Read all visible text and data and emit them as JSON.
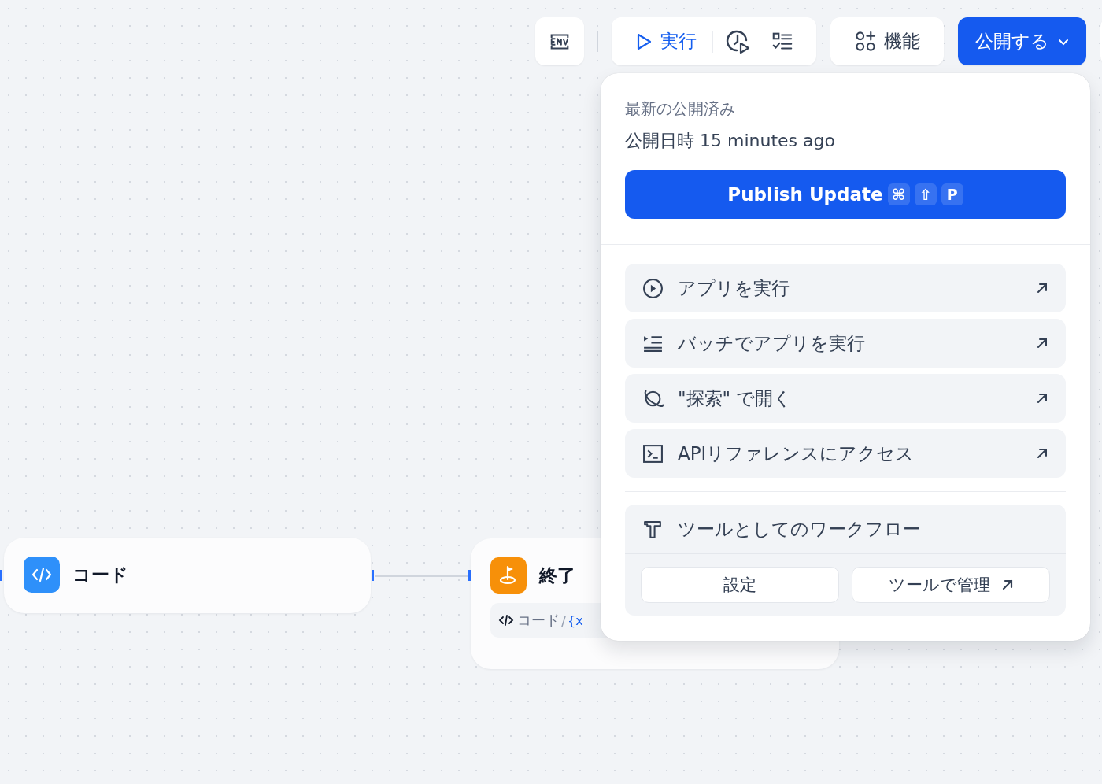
{
  "toolbar": {
    "run_button": {
      "label": "実行"
    },
    "features_button": {
      "label": "機能"
    },
    "publish_button": {
      "label": "公開する"
    }
  },
  "publish_menu": {
    "heading": "最新の公開済み",
    "published_time": "公開日時 15 minutes ago",
    "publish_update_button": {
      "label": "Publish Update",
      "shortcut_keys": [
        "⌘",
        "⇧",
        "P"
      ]
    },
    "actions": [
      {
        "kind": "run",
        "label": "アプリを実行"
      },
      {
        "kind": "batch",
        "label": "バッチでアプリを実行"
      },
      {
        "kind": "explore",
        "label": "\"探索\" で開く"
      },
      {
        "kind": "api",
        "label": "APIリファレンスにアクセス"
      }
    ],
    "tool_section": {
      "title": "ツールとしてのワークフロー",
      "settings_button": {
        "label": "設定"
      },
      "manage_button": {
        "label": "ツールで管理"
      }
    }
  },
  "canvas": {
    "nodes": [
      {
        "kind": "code",
        "title": "コード"
      },
      {
        "kind": "end",
        "title": "終了",
        "variable": {
          "source": "コード",
          "separator": "/",
          "name": "{x"
        }
      }
    ]
  }
}
